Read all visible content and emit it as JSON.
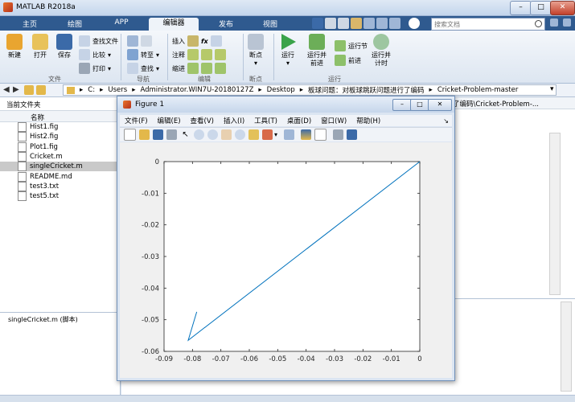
{
  "app": {
    "title": "MATLAB R2018a",
    "search_placeholder": "搜索文档"
  },
  "ribbon": {
    "tabs": [
      {
        "label": "主页"
      },
      {
        "label": "绘图"
      },
      {
        "label": "APP"
      },
      {
        "label": "编辑器",
        "active": true
      },
      {
        "label": "发布"
      },
      {
        "label": "视图"
      }
    ],
    "file_group": {
      "new": "新建",
      "open": "打开",
      "save": "保存",
      "find_files": "查找文件",
      "compare": "比较",
      "print": "打印",
      "label": "文件"
    },
    "nav_group": {
      "goto": "转至",
      "find": "查找",
      "label": "导航"
    },
    "edit_group": {
      "insert": "插入",
      "comment": "注释",
      "indent": "缩进",
      "fx": "fx",
      "label": "编辑"
    },
    "breakpoint_group": {
      "breakpoints": "断点",
      "label": "断点"
    },
    "run_group": {
      "run": "运行",
      "run_advance_1": "运行并",
      "run_advance_2": "前进",
      "run_section": "运行节",
      "advance": "前进",
      "run_time_1": "运行并",
      "run_time_2": "计时",
      "label": "运行"
    }
  },
  "address_bar": {
    "segments": [
      "C:",
      "Users",
      "Administrator.WIN7U-20180127Z",
      "Desktop",
      "板球问题：对板球跳跃问题进行了编码",
      "Cricket-Problem-master"
    ]
  },
  "current_folder": {
    "title": "当前文件夹",
    "column_name": "名称",
    "files": [
      {
        "name": "Hist1.fig",
        "selected": false
      },
      {
        "name": "Hist2.fig",
        "selected": false
      },
      {
        "name": "Plot1.fig",
        "selected": false
      },
      {
        "name": "Cricket.m",
        "selected": false
      },
      {
        "name": "singleCricket.m",
        "selected": true
      },
      {
        "name": "README.md",
        "selected": false
      },
      {
        "name": "test3.txt",
        "selected": false
      },
      {
        "name": "test5.txt",
        "selected": false
      }
    ],
    "details_label": "singleCricket.m  (脚本)"
  },
  "editor_background": {
    "path_fragment": "了编码\\Cricket-Problem-..."
  },
  "figure": {
    "title": "Figure 1",
    "menu": [
      "文件(F)",
      "编辑(E)",
      "查看(V)",
      "插入(I)",
      "工具(T)",
      "桌面(D)",
      "窗口(W)",
      "帮助(H)"
    ]
  },
  "chart_data": {
    "type": "line",
    "title": "",
    "xlabel": "",
    "ylabel": "",
    "xlim": [
      -0.09,
      0
    ],
    "ylim": [
      -0.06,
      0
    ],
    "xticks": [
      -0.09,
      -0.08,
      -0.07,
      -0.06,
      -0.05,
      -0.04,
      -0.03,
      -0.02,
      -0.01,
      0
    ],
    "yticks": [
      0,
      -0.01,
      -0.02,
      -0.03,
      -0.04,
      -0.05,
      -0.06
    ],
    "xtick_labels": [
      "-0.09",
      "-0.08",
      "-0.07",
      "-0.06",
      "-0.05",
      "-0.04",
      "-0.03",
      "-0.02",
      "-0.01",
      "0"
    ],
    "ytick_labels": [
      "0",
      "-0.01",
      "-0.02",
      "-0.03",
      "-0.04",
      "-0.05",
      "-0.06"
    ],
    "series": [
      {
        "x": [
          0,
          -0.0815,
          -0.0785
        ],
        "y": [
          0,
          -0.0565,
          -0.0475
        ],
        "color": "#0072bd"
      }
    ]
  }
}
